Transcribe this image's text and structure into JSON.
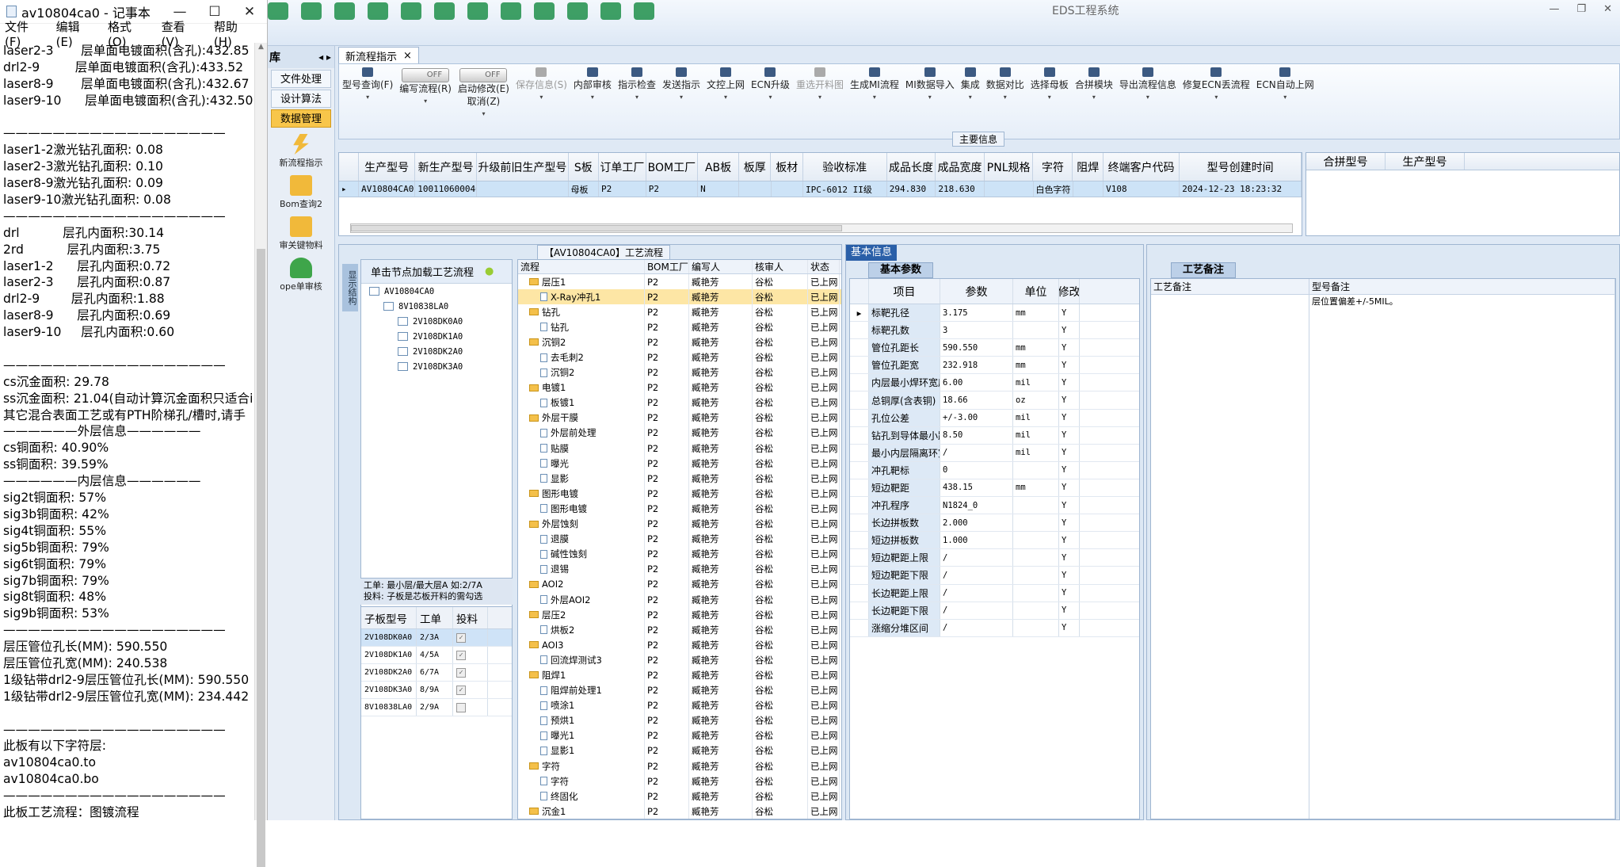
{
  "notepad": {
    "title": "av10804ca0 - 记事本",
    "window_controls": [
      "—",
      "☐",
      "✕"
    ],
    "menu": [
      "文件(F)",
      "编辑(E)",
      "格式(O)",
      "查看(V)",
      "帮助(H)"
    ],
    "lines": [
      "laser2-3       层单面电镀面积(含孔):432.85",
      "drl2-9         层单面电镀面积(含孔):433.52",
      "laser8-9       层单面电镀面积(含孔):432.67",
      "laser9-10      层单面电镀面积(含孔):432.50",
      "",
      "——————————————————",
      "laser1-2激光钻孔面积: 0.08",
      "laser2-3激光钻孔面积: 0.10",
      "laser8-9激光钻孔面积: 0.09",
      "laser9-10激光钻孔面积: 0.08",
      "——————————————————",
      "drl           层孔内面积:30.14",
      "2rd           层孔内面积:3.75",
      "laser1-2      层孔内面积:0.72",
      "laser2-3      层孔内面积:0.87",
      "drl2-9        层孔内面积:1.88",
      "laser8-9      层孔内面积:0.69",
      "laser9-10     层孔内面积:0.60",
      "",
      "——————————————————",
      "cs沉金面积: 29.78",
      "ss沉金面积: 21.04(自动计算沉金面积只适合i",
      "其它混合表面工艺或有PTH阶梯孔/槽时,请手",
      "——————外层信息——————",
      "cs铜面积: 40.90%",
      "ss铜面积: 39.59%",
      "——————内层信息——————",
      "sig2t铜面积: 57%",
      "sig3b铜面积: 42%",
      "sig4t铜面积: 55%",
      "sig5b铜面积: 79%",
      "sig6t铜面积: 79%",
      "sig7b铜面积: 79%",
      "sig8t铜面积: 48%",
      "sig9b铜面积: 53%",
      "——————————————————",
      "层压管位孔长(MM): 590.550",
      "层压管位孔宽(MM): 240.538",
      "1级钻带drl2-9层压管位孔长(MM): 590.550",
      "1级钻带drl2-9层压管位孔宽(MM): 234.442",
      "",
      "——————————————————",
      "此板有以下字符层:",
      "av10804ca0.to",
      "av10804ca0.bo",
      "——————————————————",
      "此板工艺流程：图镀流程"
    ]
  },
  "app": {
    "title": "EDS工程系统",
    "window_controls": [
      "—",
      "❐",
      "✕"
    ],
    "sidebar": {
      "header": "库",
      "buttons": [
        "文件处理",
        "设计算法",
        "数据管理"
      ],
      "items": [
        "新流程指示",
        "Bom查询2",
        "审关键物料",
        "ope单审核"
      ]
    },
    "doc_tab": "新流程指示",
    "ribbon": [
      {
        "label": "型号查询(F)",
        "state": "normal"
      },
      {
        "label": "编写流程(R)",
        "state": "toggle",
        "toggle": "OFF"
      },
      {
        "label": "启动修改(E)\n取消(Z)",
        "state": "toggle",
        "toggle": "OFF"
      },
      {
        "label": "保存信息(S)",
        "state": "disabled"
      },
      {
        "label": "内部审核",
        "state": "normal"
      },
      {
        "label": "指示检查",
        "state": "normal"
      },
      {
        "label": "发送指示",
        "state": "normal"
      },
      {
        "label": "文控上网",
        "state": "normal"
      },
      {
        "label": "ECN升级",
        "state": "normal"
      },
      {
        "label": "重选开料图",
        "state": "disabled"
      },
      {
        "label": "生成MI流程",
        "state": "normal"
      },
      {
        "label": "MI数据导入",
        "state": "normal"
      },
      {
        "label": "集成",
        "state": "normal"
      },
      {
        "label": "数据对比",
        "state": "normal"
      },
      {
        "label": "选择母板",
        "state": "normal"
      },
      {
        "label": "合拼模块",
        "state": "normal"
      },
      {
        "label": "导出流程信息",
        "state": "normal"
      },
      {
        "label": "修复ECN丢流程",
        "state": "normal"
      },
      {
        "label": "ECN自动上网",
        "state": "normal"
      }
    ],
    "main_info_label": "主要信息",
    "main_grid": {
      "headers": [
        "生产型号",
        "新生产型号",
        "升级前旧生产型号",
        "S板",
        "订单工厂",
        "BOM工厂",
        "AB板",
        "板厚",
        "板材",
        "验收标准",
        "成品长度",
        "成品宽度",
        "PNL规格",
        "字符",
        "阻焊",
        "终端客户代码",
        "型号创建时间"
      ],
      "row": [
        "AV10804CA0",
        "10011060004633",
        "",
        "母板",
        "P2",
        "P2",
        "N",
        "",
        "",
        "IPC-6012 II级",
        "294.830",
        "218.630",
        "",
        "白色字符",
        "",
        "V108",
        "2024-12-23 18:23:32"
      ]
    },
    "side_grid_headers": [
      "合拼型号",
      "生产型号"
    ],
    "flow_title": "【AV10804CA0】工艺流程",
    "side_tab": "显示结构",
    "tree": {
      "header": "单击节点加载工艺流程",
      "nodes": [
        {
          "label": "AV10804CA0",
          "level": 0
        },
        {
          "label": "8V10838LA0",
          "level": 1
        },
        {
          "label": "2V108DK0A0",
          "level": 2
        },
        {
          "label": "2V108DK1A0",
          "level": 2
        },
        {
          "label": "2V108DK2A0",
          "level": 2
        },
        {
          "label": "2V108DK3A0",
          "level": 2
        }
      ]
    },
    "note": [
      "工单: 最小层/最大层A 如:2/7A",
      "投料: 子板是芯板开料的需勾选"
    ],
    "subgrid": {
      "headers": [
        "子板型号",
        "工单",
        "投料"
      ],
      "rows": [
        [
          "2V108DK0A0",
          "2/3A",
          "✓"
        ],
        [
          "2V108DK1A0",
          "4/5A",
          "✓"
        ],
        [
          "2V108DK2A0",
          "6/7A",
          "✓"
        ],
        [
          "2V108DK3A0",
          "8/9A",
          "✓"
        ],
        [
          "8V10838LA0",
          "2/9A",
          ""
        ]
      ]
    },
    "flow_grid": {
      "headers": [
        "流程",
        "BOM工厂",
        "编写人",
        "核审人",
        "状态"
      ],
      "rows": [
        {
          "name": "层压1",
          "kind": "folder",
          "indent": 1
        },
        {
          "name": "X-Ray冲孔1",
          "kind": "doc",
          "indent": 2,
          "sel": true
        },
        {
          "name": "钻孔",
          "kind": "folder",
          "indent": 1
        },
        {
          "name": "钻孔",
          "kind": "doc",
          "indent": 2
        },
        {
          "name": "沉铜2",
          "kind": "folder",
          "indent": 1
        },
        {
          "name": "去毛刺2",
          "kind": "doc",
          "indent": 2
        },
        {
          "name": "沉铜2",
          "kind": "doc",
          "indent": 2
        },
        {
          "name": "电镀1",
          "kind": "folder",
          "indent": 1
        },
        {
          "name": "板镀1",
          "kind": "doc",
          "indent": 2
        },
        {
          "name": "外层干膜",
          "kind": "folder",
          "indent": 1
        },
        {
          "name": "外层前处理",
          "kind": "doc",
          "indent": 2
        },
        {
          "name": "贴膜",
          "kind": "doc",
          "indent": 2
        },
        {
          "name": "曝光",
          "kind": "doc",
          "indent": 2
        },
        {
          "name": "显影",
          "kind": "doc",
          "indent": 2
        },
        {
          "name": "图形电镀",
          "kind": "folder",
          "indent": 1
        },
        {
          "name": "图形电镀",
          "kind": "doc",
          "indent": 2
        },
        {
          "name": "外层蚀刻",
          "kind": "folder",
          "indent": 1
        },
        {
          "name": "退膜",
          "kind": "doc",
          "indent": 2
        },
        {
          "name": "碱性蚀刻",
          "kind": "doc",
          "indent": 2
        },
        {
          "name": "退锡",
          "kind": "doc",
          "indent": 2
        },
        {
          "name": "AOI2",
          "kind": "folder",
          "indent": 1
        },
        {
          "name": "外层AOI2",
          "kind": "doc",
          "indent": 2
        },
        {
          "name": "层压2",
          "kind": "folder",
          "indent": 1
        },
        {
          "name": "烘板2",
          "kind": "doc",
          "indent": 2
        },
        {
          "name": "AOI3",
          "kind": "folder",
          "indent": 1
        },
        {
          "name": "回流焊测试3",
          "kind": "doc",
          "indent": 2
        },
        {
          "name": "阻焊1",
          "kind": "folder",
          "indent": 1
        },
        {
          "name": "阻焊前处理1",
          "kind": "doc",
          "indent": 2
        },
        {
          "name": "喷涂1",
          "kind": "doc",
          "indent": 2
        },
        {
          "name": "预烘1",
          "kind": "doc",
          "indent": 2
        },
        {
          "name": "曝光1",
          "kind": "doc",
          "indent": 2
        },
        {
          "name": "显影1",
          "kind": "doc",
          "indent": 2
        },
        {
          "name": "字符",
          "kind": "folder",
          "indent": 1
        },
        {
          "name": "字符",
          "kind": "doc",
          "indent": 2
        },
        {
          "name": "终固化",
          "kind": "doc",
          "indent": 2
        },
        {
          "name": "沉金1",
          "kind": "folder",
          "indent": 1
        }
      ],
      "common": {
        "bom": "P2",
        "writer": "臧艳芳",
        "reviewer": "谷松",
        "status": "已上网"
      }
    },
    "basic": {
      "title": "基本信息",
      "tab": "基本参数",
      "headers": [
        "项目",
        "参数",
        "单位",
        "修改"
      ],
      "rows": [
        [
          "标靶孔径",
          "3.175",
          "mm",
          "Y"
        ],
        [
          "标靶孔数",
          "3",
          "",
          "Y"
        ],
        [
          "管位孔距长",
          "590.550",
          "mm",
          "Y"
        ],
        [
          "管位孔距宽",
          "232.918",
          "mm",
          "Y"
        ],
        [
          "内层最小焊环宽度",
          "6.00",
          "mil",
          "Y"
        ],
        [
          "总铜厚(含表铜)",
          "18.66",
          "oz",
          "Y"
        ],
        [
          "孔位公差",
          "+/-3.00",
          "mil",
          "Y"
        ],
        [
          "钻孔到导体最小距离",
          "8.50",
          "mil",
          "Y"
        ],
        [
          "最小内层隔离环宽度",
          "/",
          "mil",
          "Y"
        ],
        [
          "冲孔靶标",
          "0",
          "",
          "Y"
        ],
        [
          "短边靶距",
          "438.15",
          "mm",
          "Y"
        ],
        [
          "冲孔程序",
          "N1824_0",
          "",
          "Y"
        ],
        [
          "长边拼板数",
          "2.000",
          "",
          "Y"
        ],
        [
          "短边拼板数",
          "1.000",
          "",
          "Y"
        ],
        [
          "短边靶距上限",
          "/",
          "",
          "Y"
        ],
        [
          "短边靶距下限",
          "/",
          "",
          "Y"
        ],
        [
          "长边靶距上限",
          "/",
          "",
          "Y"
        ],
        [
          "长边靶距下限",
          "/",
          "",
          "Y"
        ],
        [
          "涨缩分堆区间",
          "/",
          "",
          "Y"
        ]
      ]
    },
    "remark": {
      "tab": "工艺备注",
      "col1": "工艺备注",
      "col2": "型号备注",
      "col2_value": "层位置偏差+/-5MIL。"
    }
  }
}
